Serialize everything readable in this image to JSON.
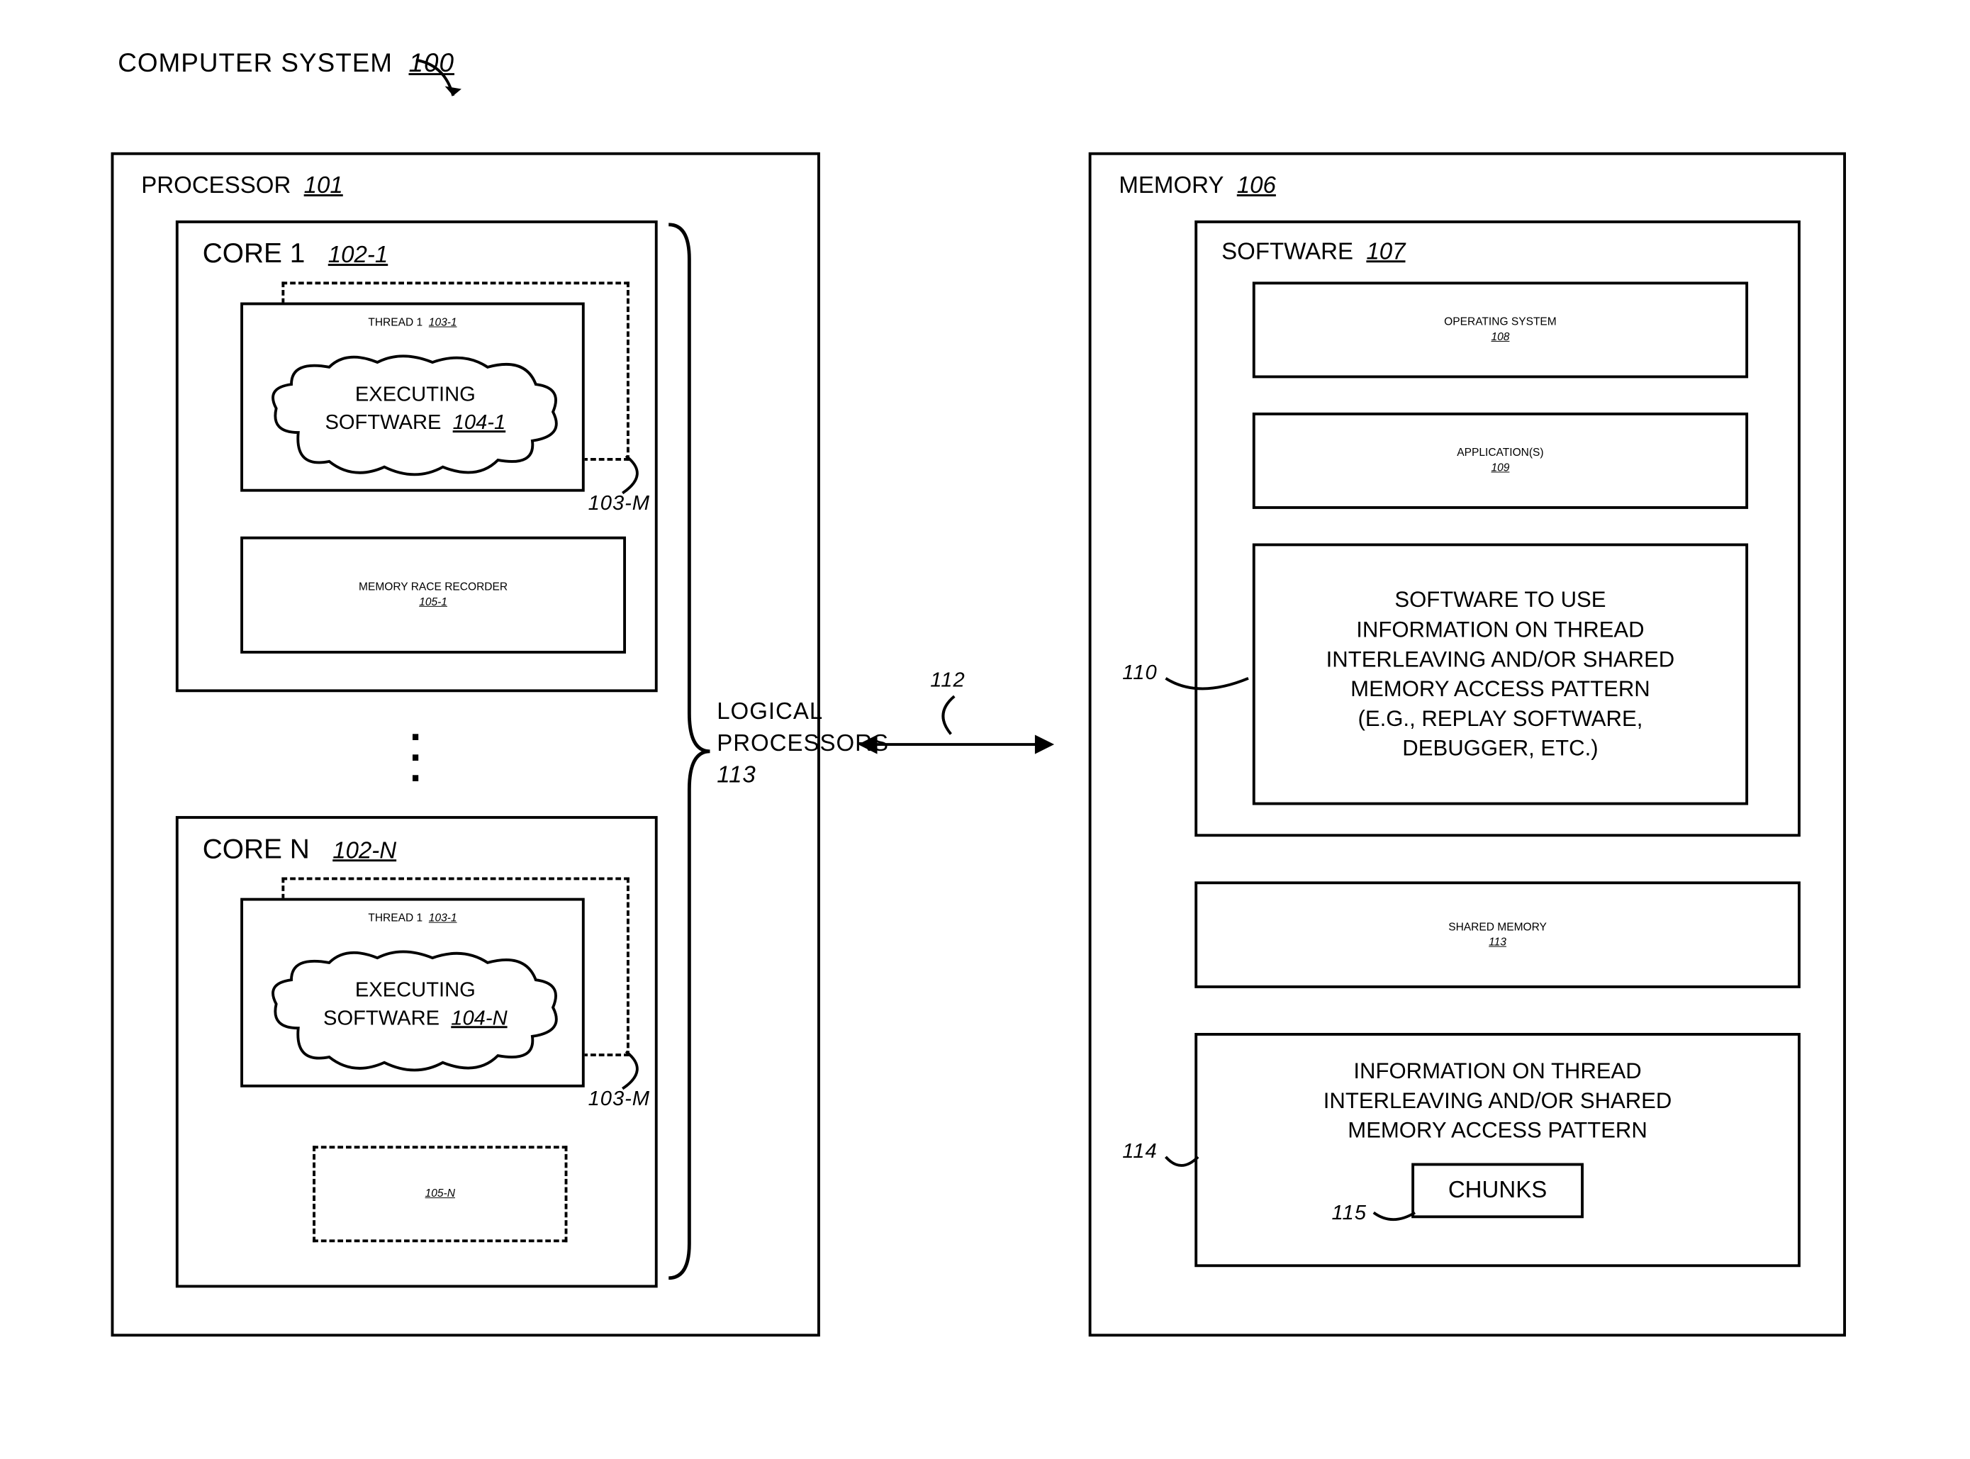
{
  "title": {
    "text": "COMPUTER SYSTEM",
    "ref": "100"
  },
  "processor": {
    "label": "PROCESSOR",
    "ref": "101",
    "core1": {
      "label": "CORE 1",
      "ref": "102-1",
      "threadGroup": {
        "label": "THREAD 1",
        "ref": "103-1",
        "mRef": "103-M"
      },
      "cloud": {
        "line1": "EXECUTING",
        "line2": "SOFTWARE",
        "ref": "104-1"
      },
      "mrr": {
        "label": "MEMORY RACE RECORDER",
        "ref": "105-1"
      }
    },
    "coreN": {
      "label": "CORE N",
      "ref": "102-N",
      "threadGroup": {
        "label": "THREAD 1",
        "ref": "103-1",
        "mRef": "103-M"
      },
      "cloud": {
        "line1": "EXECUTING",
        "line2": "SOFTWARE",
        "ref": "104-N"
      },
      "mrrRef": "105-N"
    },
    "logicalProcessors": {
      "label": "LOGICAL\nPROCESSORS",
      "ref": "113"
    }
  },
  "link": {
    "ref": "112"
  },
  "memory": {
    "label": "MEMORY",
    "ref": "106",
    "software": {
      "label": "SOFTWARE",
      "ref": "107",
      "os": {
        "label": "OPERATING SYSTEM",
        "ref": "108"
      },
      "apps": {
        "label": "APPLICATION(S)",
        "ref": "109"
      },
      "useInfo": {
        "label": "SOFTWARE TO USE\nINFORMATION ON THREAD\nINTERLEAVING AND/OR SHARED\nMEMORY ACCESS PATTERN\n(E.G., REPLAY SOFTWARE,\nDEBUGGER, ETC.)",
        "ref": "110"
      }
    },
    "sharedMem": {
      "label": "SHARED MEMORY",
      "ref": "113"
    },
    "info": {
      "label": "INFORMATION ON THREAD\nINTERLEAVING AND/OR SHARED\nMEMORY ACCESS PATTERN",
      "ref": "114",
      "chunks": {
        "label": "CHUNKS",
        "ref": "115"
      }
    }
  }
}
